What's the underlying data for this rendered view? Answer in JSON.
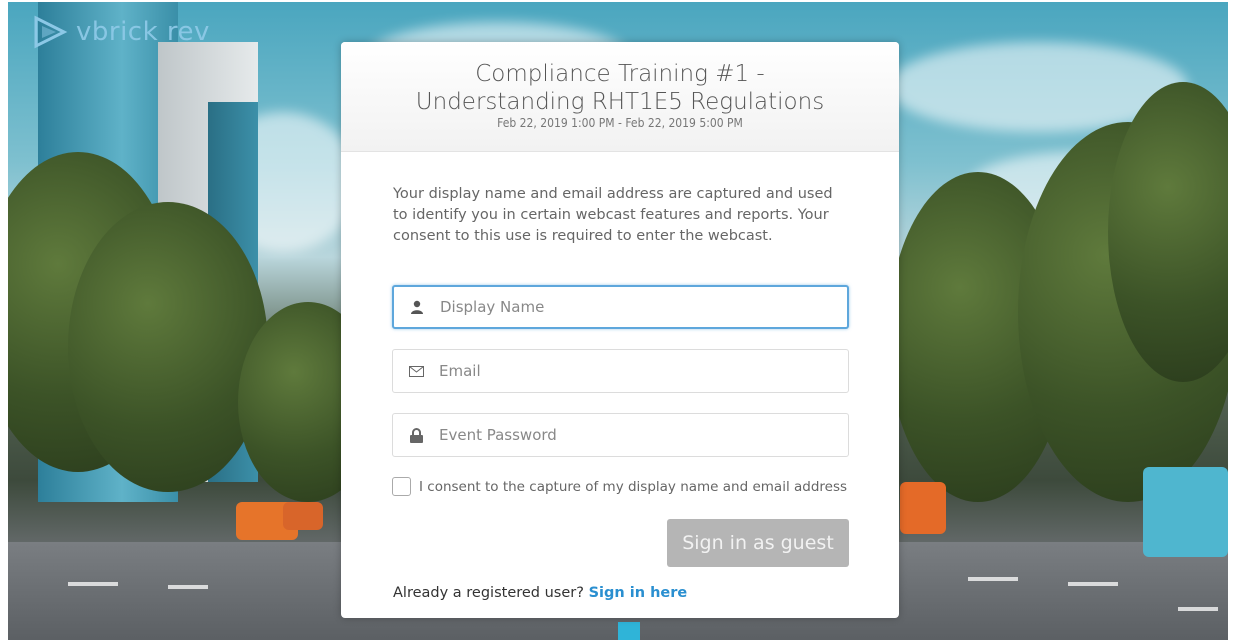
{
  "brand": {
    "logo_text": "vbrick rev"
  },
  "event": {
    "title_line1": "Compliance Training #1 -",
    "title_line2": "Understanding RHT1E5 Regulations",
    "schedule": "Feb 22, 2019 1:00 PM - Feb 22, 2019 5:00 PM"
  },
  "intro_text": "Your display name and email address are captured and used to identify you in certain webcast features and reports. Your consent to this use is required to enter the webcast.",
  "form": {
    "display_name_placeholder": "Display Name",
    "email_placeholder": "Email",
    "password_placeholder": "Event Password",
    "consent_label": "I consent to the capture of my display name and email address",
    "consent_checked": false,
    "submit_label": "Sign in as guest"
  },
  "footer": {
    "prompt": "Already a registered user?",
    "link_label": "Sign in here"
  },
  "icons": {
    "display_name": "user-icon",
    "email": "envelope-icon",
    "password": "lock-icon"
  },
  "colors": {
    "focus_border": "#5ea7dc",
    "link": "#2a8fd0",
    "button_disabled": "#b5b5b5"
  }
}
